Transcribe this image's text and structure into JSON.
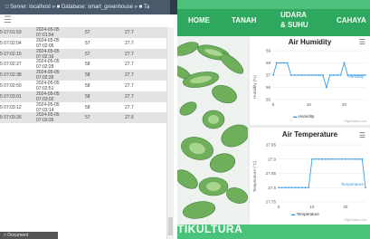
{
  "browser": {
    "tab_text": "□ Server: localhost » ■ Database: smart_greenhouse » ■ Ta"
  },
  "taskbar": {
    "label": "□ Document"
  },
  "table": {
    "rows": [
      {
        "id": "5 07:01:53",
        "date": "2024-05-05",
        "time": "07:01:54",
        "v1": "57",
        "v2": "27.7"
      },
      {
        "id": "5 07:02:04",
        "date": "2024-05-05",
        "time": "07:02:05",
        "v1": "57",
        "v2": "27.7"
      },
      {
        "id": "5 07:02:15",
        "date": "2024-05-05",
        "time": "07:02:16",
        "v1": "57",
        "v2": "27.7"
      },
      {
        "id": "5 07:02:27",
        "date": "2024-05-05",
        "time": "07:02:28",
        "v1": "58",
        "v2": "27.7"
      },
      {
        "id": "5 07:02:38",
        "date": "2024-05-05",
        "time": "07:02:39",
        "v1": "58",
        "v2": "27.7"
      },
      {
        "id": "5 07:02:50",
        "date": "2024-05-05",
        "time": "07:02:51",
        "v1": "58",
        "v2": "27.7"
      },
      {
        "id": "5 07:03:01",
        "date": "2024-05-05",
        "time": "07:03:02",
        "v1": "58",
        "v2": "27.7"
      },
      {
        "id": "5 07:03:12",
        "date": "2024-05-05",
        "time": "07:03:14",
        "v1": "58",
        "v2": "27.7"
      },
      {
        "id": "5 07:03:26",
        "date": "2024-05-05",
        "time": "07:03:26",
        "v1": "57",
        "v2": "27.6"
      }
    ]
  },
  "nav": {
    "home": "HOME",
    "tanah": "TANAH",
    "udara1": "UDARA",
    "udara2": "& SUHU",
    "cahaya": "CAHAYA"
  },
  "footer_text": "TIKULTURA",
  "colors": {
    "nav": "#2fa85f",
    "series": "#3a9ee8",
    "footer": "#49c27a"
  },
  "charts": [
    {
      "title": "Air Humidity",
      "ylabel": "Humidity (%)",
      "yticks": [
        "59",
        "58",
        "57",
        "56",
        "55"
      ],
      "xticks": [
        "0",
        "10",
        "20"
      ],
      "series_name": "Humidity",
      "legend": "Humidity",
      "credit": "Highcharts.com",
      "chart_data": {
        "type": "line",
        "title": "Air Humidity",
        "ylabel": "Humidity (%)",
        "ylim": [
          55,
          59
        ],
        "x": [
          0,
          1,
          2,
          3,
          4,
          5,
          6,
          7,
          8,
          9,
          10,
          11,
          12,
          13,
          14,
          15,
          16,
          17,
          18,
          19,
          20,
          21,
          22,
          23,
          24,
          25,
          26
        ],
        "series": [
          {
            "name": "Humidity",
            "values": [
              57,
              58,
              58,
              58,
              58,
              57,
              57,
              57,
              57,
              57,
              57,
              57,
              57,
              57,
              57,
              56,
              57,
              57,
              57,
              57,
              58,
              57,
              57,
              57,
              57,
              57,
              57
            ]
          }
        ]
      }
    },
    {
      "title": "Air Temperature",
      "ylabel": "Temperature (°C)",
      "yticks": [
        "27.95",
        "27.9",
        "27.85",
        "27.8",
        "27.75"
      ],
      "xticks": [
        "0",
        "10",
        "20"
      ],
      "series_name": "Temperature",
      "legend": "Temperature",
      "credit": "Highcharts.com",
      "chart_data": {
        "type": "line",
        "title": "Air Temperature",
        "ylabel": "Temperature (°C)",
        "ylim": [
          27.75,
          27.95
        ],
        "x": [
          0,
          1,
          2,
          3,
          4,
          5,
          6,
          7,
          8,
          9,
          10,
          11,
          12,
          13,
          14,
          15,
          16,
          17,
          18,
          19,
          20,
          21,
          22,
          23,
          24,
          25,
          26
        ],
        "series": [
          {
            "name": "Temperature",
            "values": [
              27.8,
              27.8,
              27.8,
              27.8,
              27.8,
              27.8,
              27.8,
              27.8,
              27.8,
              27.8,
              27.9,
              27.9,
              27.9,
              27.9,
              27.9,
              27.9,
              27.9,
              27.9,
              27.9,
              27.9,
              27.9,
              27.9,
              27.9,
              27.9,
              27.9,
              27.9,
              27.8
            ]
          }
        ]
      }
    }
  ]
}
